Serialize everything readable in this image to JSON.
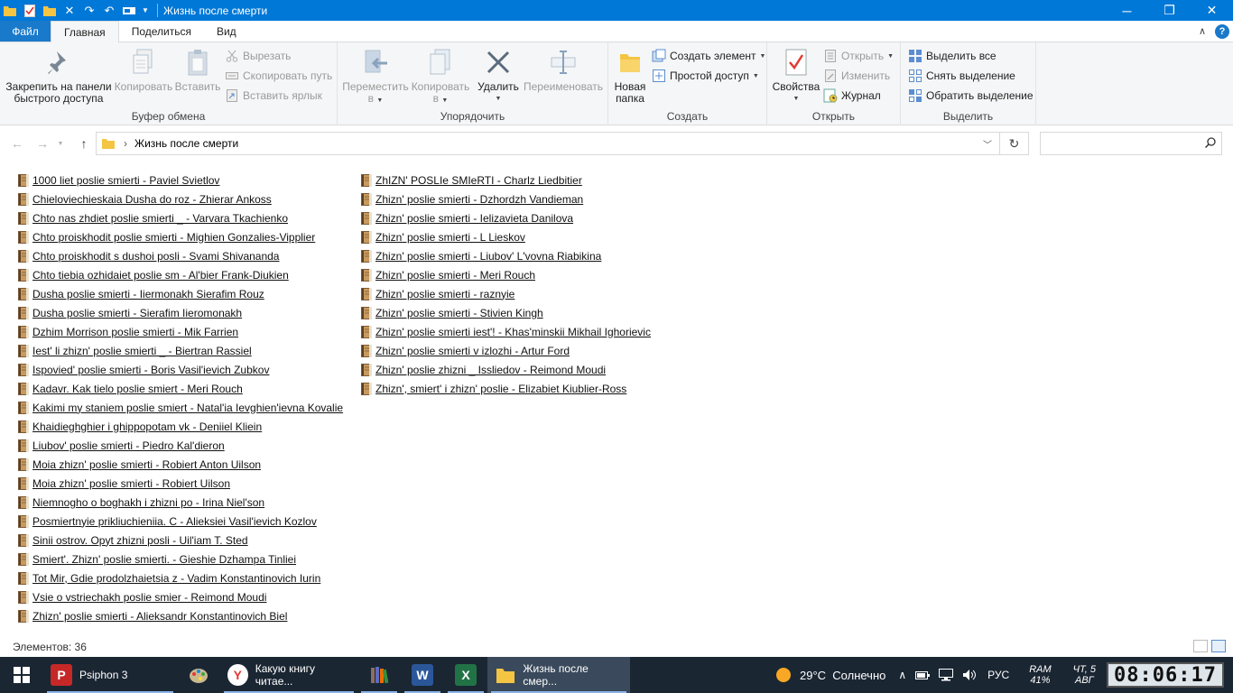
{
  "window": {
    "title": "Жизнь после смерти"
  },
  "tabs": {
    "file": "Файл",
    "home": "Главная",
    "share": "Поделиться",
    "view": "Вид"
  },
  "ribbon": {
    "clipboard": {
      "label": "Буфер обмена",
      "pin": [
        "Закрепить на панели",
        "быстрого доступа"
      ],
      "copy": "Копировать",
      "paste": "Вставить",
      "cut": "Вырезать",
      "copy_path": "Скопировать путь",
      "paste_shortcut": "Вставить ярлык"
    },
    "organize": {
      "label": "Упорядочить",
      "move_to": [
        "Переместить",
        "в"
      ],
      "copy_to": [
        "Копировать",
        "в"
      ],
      "delete": "Удалить",
      "rename": "Переименовать"
    },
    "create": {
      "label": "Создать",
      "new_folder": [
        "Новая",
        "папка"
      ],
      "new_item": "Создать элемент",
      "easy_access": "Простой доступ"
    },
    "open": {
      "label": "Открыть",
      "properties": "Свойства",
      "open": "Открыть",
      "edit": "Изменить",
      "history": "Журнал"
    },
    "select": {
      "label": "Выделить",
      "select_all": "Выделить все",
      "select_none": "Снять выделение",
      "invert": "Обратить выделение"
    }
  },
  "address": {
    "path": "Жизнь после смерти",
    "separator": "›"
  },
  "files_col1": [
    "1000 liet poslie smierti - Paviel Svietlov",
    "Chieloviechieskaia Dusha do roz - Zhierar Ankoss",
    "Chto nas zhdiet poslie smierti _ - Varvara Tkachienko",
    "Chto proiskhodit poslie smierti - Mighien Gonzalies-Vipplier",
    "Chto proiskhodit s dushoi posli - Svami Shivananda",
    "Chto tiebia ozhidaiet poslie sm - Al'bier Frank-Diukien",
    "Dusha poslie smierti - Iiermonakh Sierafim Rouz",
    "Dusha poslie smierti - Sierafim Iieromonakh",
    "Dzhim Morrison poslie smierti - Mik Farrien",
    "Iest' li zhizn' poslie smierti _ - Biertran Rassiel",
    "Ispovied' poslie smierti - Boris Vasil'ievich Zubkov",
    "Kadavr. Kak tielo poslie smiert - Meri Rouch",
    "Kakimi my staniem poslie smiert - Natal'ia Ievghien'ievna Kovalie",
    "Khaidieghghier i ghippopotam vk - Deniiel Kliein",
    "Liubov' poslie smierti - Piedro Kal'dieron",
    "Moia zhizn' poslie smierti - Robiert Anton Uilson",
    "Moia zhizn' poslie smierti - Robiert Uilson",
    "Niemnogho o boghakh i zhizni po - Irina Niel'son",
    "Posmiertnyie prikliuchieniia. C - Alieksiei Vasil'ievich Kozlov",
    "Sinii ostrov. Opyt zhizni posli - Uil'iam T. Sted",
    "Smiert'. Zhizn' poslie smierti. - Gieshie Dzhampa Tinliei",
    "Tot Mir, Gdie prodolzhaietsia z - Vadim Konstantinovich Iurin",
    "Vsie o vstriechakh poslie smier - Reimond Moudi",
    "Zhizn' poslie smierti - Alieksandr Konstantinovich Biel"
  ],
  "files_col2": [
    "ZhIZN' POSLIe SMIeRTI - Charlz Liedbitier",
    "Zhizn' poslie smierti - Dzhordzh Vandieman",
    "Zhizn' poslie smierti - Ielizavieta Danilova",
    "Zhizn' poslie smierti - L Lieskov",
    "Zhizn' poslie smierti - Liubov' L'vovna Riabikina",
    "Zhizn' poslie smierti - Meri Rouch",
    "Zhizn' poslie smierti - raznyie",
    "Zhizn' poslie smierti - Stivien Kingh",
    "Zhizn' poslie smierti iest'! - Khas'minskii Mikhail Ighorievic",
    "Zhizn' poslie smierti v izlozhi - Artur Ford",
    "Zhizn' poslie zhizni _ Issliedov - Reimond Moudi",
    "Zhizn', smiert' i zhizn' poslie - Elizabiet Kiublier-Ross"
  ],
  "status": {
    "items": "Элементов: 36"
  },
  "taskbar": {
    "psiphon": "Psiphon 3",
    "yandex": "Какую книгу читае...",
    "explorer": "Жизнь после смер...",
    "weather": "29°C  Солнечно",
    "lang": "РУС",
    "ram_label": "RAM",
    "ram_value": "41%",
    "day": "ЧТ, 5",
    "month": "АВГ",
    "clock": "08:06:17"
  },
  "colors": {
    "titlebar": "#0078d7",
    "file_tab": "#1979ca",
    "taskbar": "#1b2633",
    "folder": "#f4c542"
  }
}
